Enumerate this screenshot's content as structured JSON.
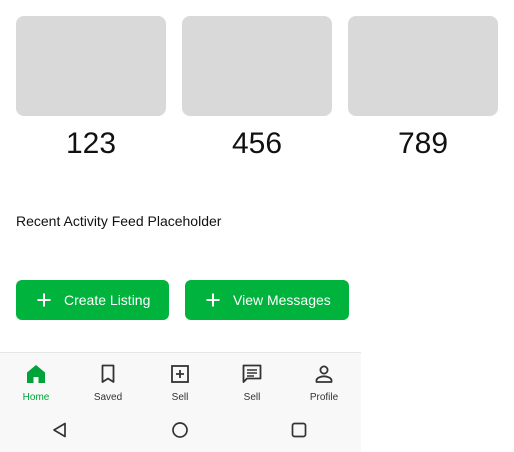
{
  "stats": [
    {
      "value": "123"
    },
    {
      "value": "456"
    },
    {
      "value": "789"
    }
  ],
  "activity": {
    "text": "Recent Activity Feed Placeholder"
  },
  "actions": {
    "create_label": "Create Listing",
    "messages_label": "View Messages"
  },
  "bottom_nav": {
    "active_color": "#00a33a",
    "items": [
      {
        "label": "Home",
        "icon": "home-icon",
        "active": true
      },
      {
        "label": "Saved",
        "icon": "bookmark-icon"
      },
      {
        "label": "Sell",
        "icon": "add-box-icon"
      },
      {
        "label": "Sell",
        "icon": "message-icon"
      },
      {
        "label": "Profile",
        "icon": "person-icon"
      }
    ]
  },
  "system_nav": {
    "buttons": [
      "back-icon",
      "home-circle-icon",
      "recents-icon"
    ]
  },
  "colors": {
    "primary_button": "#00b33c",
    "placeholder": "#d9d9d9"
  }
}
